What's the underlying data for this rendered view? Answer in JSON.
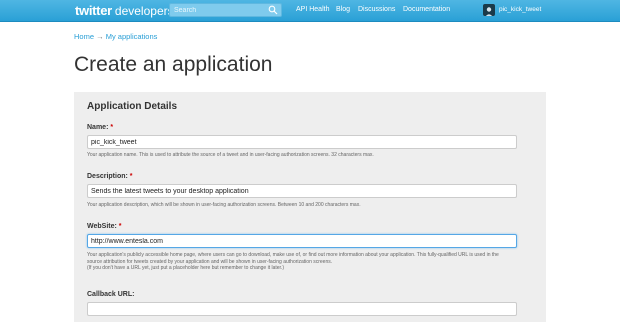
{
  "header": {
    "brand": "twitter",
    "brand_sub": "developers",
    "search_placeholder": "Search",
    "nav": [
      "API Health",
      "Blog",
      "Discussions",
      "Documentation"
    ],
    "username": "pic_kick_tweet"
  },
  "breadcrumb": {
    "home": "Home",
    "separator": "→",
    "current": "My applications"
  },
  "page_title": "Create an application",
  "form": {
    "section_title": "Application Details",
    "name": {
      "label": "Name:",
      "required_mark": "*",
      "value": "pic_kick_tweet",
      "help": "Your application name. This is used to attribute the source of a tweet and in user-facing authorization screens. 32 characters max."
    },
    "description": {
      "label": "Description:",
      "required_mark": "*",
      "value": "Sends the latest tweets to your desktop application",
      "help": "Your application description, which will be shown in user-facing authorization screens. Between 10 and 200 characters max."
    },
    "website": {
      "label": "WebSite:",
      "required_mark": "*",
      "value": "http://www.entesla.com",
      "help_line1": "Your application's publicly accessible home page, where users can go to download, make use of, or find out more information about your application. This fully-qualified URL is used in the",
      "help_line2": "source attribution for tweets created by your application and will be shown in user-facing authorization screens.",
      "help_line3": "(If you don't have a URL yet, just put a placeholder here but remember to change it later.)"
    },
    "callback": {
      "label": "Callback URL:",
      "value": ""
    }
  },
  "colors": {
    "topbar": "#2aa0d6",
    "link": "#2a9fd6",
    "panel": "#eeeeee",
    "required": "#cc0000"
  }
}
